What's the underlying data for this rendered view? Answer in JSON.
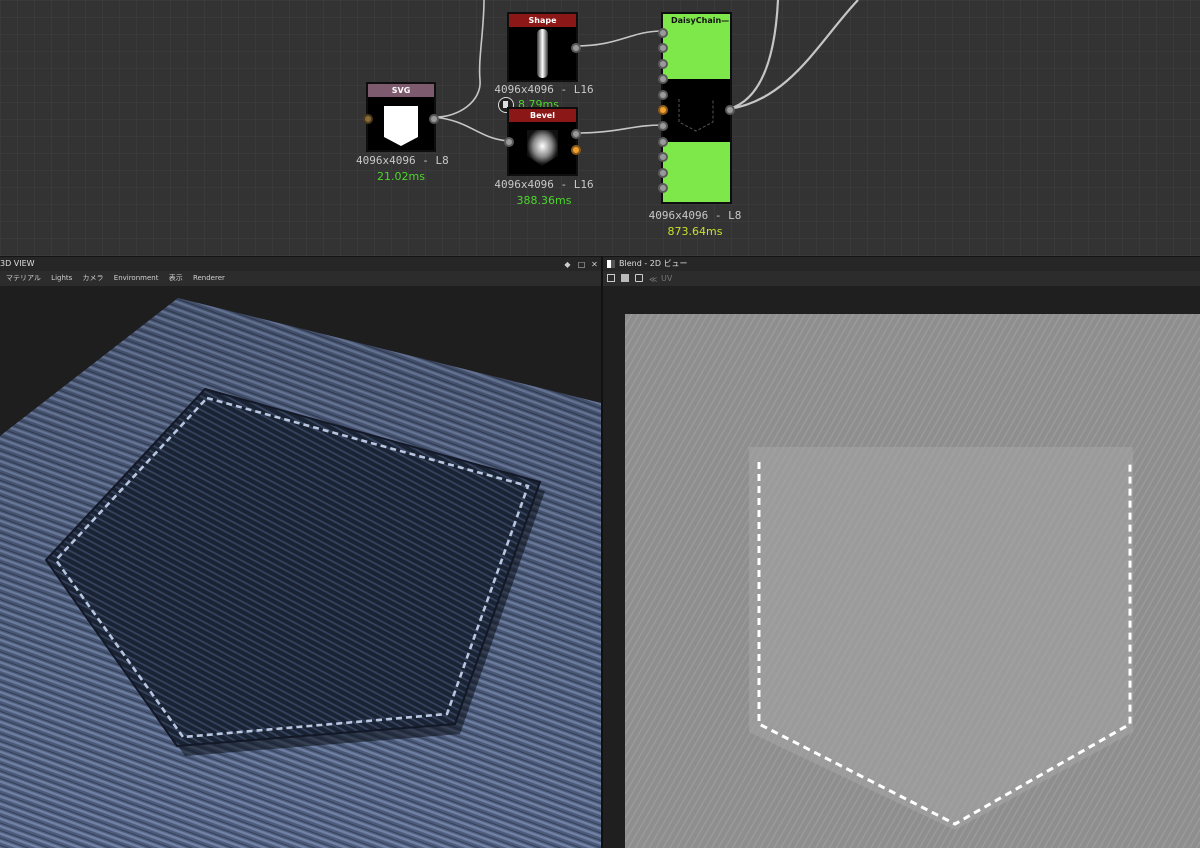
{
  "nodes": {
    "shape": {
      "title": "Shape",
      "info": "4096x4096 - L16",
      "time": "8.79ms"
    },
    "svg": {
      "title": "SVG",
      "info": "4096x4096 - L8",
      "time": "21.02ms"
    },
    "bevel": {
      "title": "Bevel",
      "info": "4096x4096 - L16",
      "time": "388.36ms"
    },
    "daisy": {
      "title": "DaisyChain—",
      "info": "4096x4096 - L8",
      "time": "873.64ms"
    }
  },
  "view3d": {
    "title": "3D VIEW",
    "menu": [
      "マテリアル",
      "Lights",
      "カメラ",
      "Environment",
      "表示",
      "Renderer"
    ]
  },
  "view2d": {
    "title": "Blend - 2D ビュー",
    "uv_label": "UV"
  },
  "colors": {
    "graph_bg": "#333333",
    "node_red": "#8c1717",
    "node_green": "#7ee84a",
    "time_green": "#4cd62c",
    "time_yellow": "#c8e02c"
  }
}
